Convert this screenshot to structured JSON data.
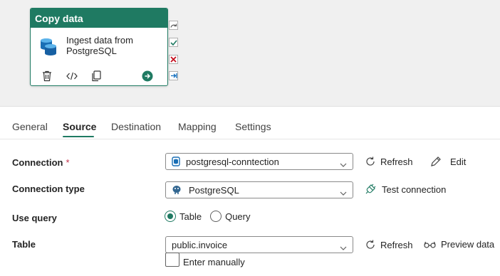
{
  "activity": {
    "header": "Copy data",
    "description": "Ingest data from PostgreSQL",
    "actions": [
      "delete-icon",
      "code-icon",
      "copy-icon",
      "go-icon"
    ],
    "ports": [
      "skip-icon",
      "success-icon",
      "failure-icon",
      "completion-icon"
    ]
  },
  "tabs": [
    {
      "label": "General",
      "active": false
    },
    {
      "label": "Source",
      "active": true
    },
    {
      "label": "Destination",
      "active": false
    },
    {
      "label": "Mapping",
      "active": false
    },
    {
      "label": "Settings",
      "active": false
    }
  ],
  "form": {
    "connection": {
      "label": "Connection",
      "required_mark": "*",
      "value": "postgresql-conntection",
      "refresh_label": "Refresh",
      "edit_label": "Edit"
    },
    "connection_type": {
      "label": "Connection type",
      "value": "PostgreSQL",
      "test_label": "Test connection"
    },
    "use_query": {
      "label": "Use query",
      "options": [
        {
          "label": "Table",
          "checked": true
        },
        {
          "label": "Query",
          "checked": false
        }
      ]
    },
    "table": {
      "label": "Table",
      "value": "public.invoice",
      "refresh_label": "Refresh",
      "preview_label": "Preview data",
      "enter_manually_label": "Enter manually",
      "enter_manually_checked": false
    }
  },
  "colors": {
    "accent": "#1f7a62",
    "required": "#c4314b",
    "failure": "#c50f1f",
    "info": "#0f6cbd"
  }
}
